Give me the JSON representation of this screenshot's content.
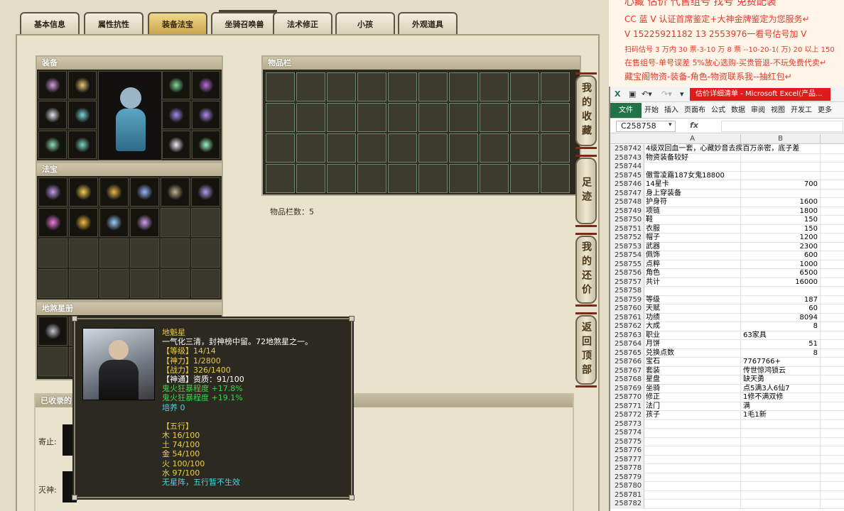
{
  "game": {
    "tabs": [
      "基本信息",
      "属性抗性",
      "装备法宝",
      "坐骑召唤兽",
      "法术修正",
      "小孩",
      "外观道具"
    ],
    "active_tab": "装备法宝",
    "equipment_title": "装备",
    "fabao_title": "法宝",
    "inventory_title": "物品栏",
    "inventory_count": "物品栏数：5",
    "star_title": "地煞星册",
    "collected_title": "已收录的",
    "collected_labels": [
      "寄止:",
      "灭神:"
    ],
    "side_buttons": {
      "favorites": "我的收藏",
      "footprint": "足迹",
      "bargain": "我的还价",
      "back_top": "返回顶部"
    },
    "tooltip": {
      "name": "地魁星",
      "lines": [
        {
          "text": "一气化三清，封神榜中留。72地煞星之一。",
          "color": "white"
        },
        {
          "text": "【等级】14/14",
          "color": "gold"
        },
        {
          "text": "【神力】1/2800",
          "color": "gold"
        },
        {
          "text": "【战力】326/1400",
          "color": "gold"
        },
        {
          "text": "【神通】资质：91/100",
          "color": "white"
        },
        {
          "text": "鬼火狂暴程度 +17.8%",
          "color": "green"
        },
        {
          "text": "鬼火狂暴程度 +19.1%",
          "color": "green"
        },
        {
          "text": "培养 0",
          "color": "cyan"
        },
        {
          "text": "",
          "color": "white"
        },
        {
          "text": "【五行】",
          "color": "gold"
        },
        {
          "text": "木 16/100",
          "color": "yel"
        },
        {
          "text": "土 74/100",
          "color": "yel"
        },
        {
          "text": "金 54/100",
          "color": "yel"
        },
        {
          "text": "火 100/100",
          "color": "yel"
        },
        {
          "text": "水 97/100",
          "color": "yel"
        },
        {
          "text": "无星阵，五行暂不生效",
          "color": "cyan"
        }
      ]
    }
  },
  "ad": {
    "lines": [
      "心藏 估价 代售组号 找号 免费配装",
      "CC 蓝 V 认证首席鉴定+大神金牌鉴定为您服务↵",
      "V 15225921182      13 2553976一看号估号加 V",
      "扫码估号 3 万内 30 票-3-10 万 8 票 --10-20-1( 万) 20 以上 150",
      "在售组号-单号误差 5%放心选购-买贵管退-不玩免费代卖↵",
      "藏宝阁物资-装备-角色-物资联系我--抽红包↵"
    ]
  },
  "excel": {
    "title": "估价详细清单 - Microsoft Excel(产品...",
    "ribbon": [
      "文件",
      "开始",
      "插入",
      "页面布",
      "公式",
      "数据",
      "审阅",
      "视图",
      "开发工",
      "更多"
    ],
    "name_box": "C258758",
    "fx": "fx",
    "col_a": "A",
    "col_b": "B",
    "rows": [
      {
        "n": "258742",
        "a": "4级双回血一套，心藏妙音去疾百万亲密，底子差",
        "b": ""
      },
      {
        "n": "258743",
        "a": "物资装备较好",
        "b": ""
      },
      {
        "n": "258744",
        "a": "",
        "b": ""
      },
      {
        "n": "258745",
        "a": "傲雪凌霜187女鬼18800",
        "b": ""
      },
      {
        "n": "258746",
        "a": "14星卡",
        "b": "700"
      },
      {
        "n": "258747",
        "a": "身上穿装备",
        "b": ""
      },
      {
        "n": "258748",
        "a": "护身符",
        "b": "1600"
      },
      {
        "n": "258749",
        "a": "项链",
        "b": "1800"
      },
      {
        "n": "258750",
        "a": "鞋",
        "b": "150"
      },
      {
        "n": "258751",
        "a": "衣服",
        "b": "150"
      },
      {
        "n": "258752",
        "a": "帽子",
        "b": "1200"
      },
      {
        "n": "258753",
        "a": "武器",
        "b": "2300"
      },
      {
        "n": "258754",
        "a": "佩饰",
        "b": "600"
      },
      {
        "n": "258755",
        "a": "点粹",
        "b": "1000"
      },
      {
        "n": "258756",
        "a": "角色",
        "b": "6500"
      },
      {
        "n": "258757",
        "a": "共计",
        "b": "16000"
      },
      {
        "n": "258758",
        "a": "",
        "b": ""
      },
      {
        "n": "258759",
        "a": "等级",
        "b": "187"
      },
      {
        "n": "258760",
        "a": "天赋",
        "b": "60"
      },
      {
        "n": "258761",
        "a": "功绩",
        "b": "8094"
      },
      {
        "n": "258762",
        "a": "大成",
        "b": "8"
      },
      {
        "n": "258763",
        "a": "职业",
        "b": "63家具"
      },
      {
        "n": "258764",
        "a": "月饼",
        "b": "51"
      },
      {
        "n": "258765",
        "a": "兑换点数",
        "b": "8"
      },
      {
        "n": "258766",
        "a": "宝石",
        "b": "7767766+"
      },
      {
        "n": "258767",
        "a": "套装",
        "b": "传世惊鸿锁云"
      },
      {
        "n": "258768",
        "a": "星盘",
        "b": "缺天勇"
      },
      {
        "n": "258769",
        "a": "坐骑",
        "b": "点5满3人6仙7"
      },
      {
        "n": "258770",
        "a": "修正",
        "b": "1修不满双修"
      },
      {
        "n": "258771",
        "a": "法门",
        "b": "满"
      },
      {
        "n": "258772",
        "a": "孩子",
        "b": "1毛1新"
      },
      {
        "n": "258773",
        "a": "",
        "b": ""
      },
      {
        "n": "258774",
        "a": "",
        "b": ""
      },
      {
        "n": "258775",
        "a": "",
        "b": ""
      },
      {
        "n": "258776",
        "a": "",
        "b": ""
      },
      {
        "n": "258777",
        "a": "",
        "b": ""
      },
      {
        "n": "258778",
        "a": "",
        "b": ""
      },
      {
        "n": "258779",
        "a": "",
        "b": ""
      },
      {
        "n": "258780",
        "a": "",
        "b": ""
      },
      {
        "n": "258781",
        "a": "",
        "b": ""
      },
      {
        "n": "258782",
        "a": "",
        "b": ""
      }
    ]
  },
  "colors": {
    "ad_red": "#e23a2a",
    "excel_green": "#217346",
    "title_red": "#e11b1b",
    "tab_active": "#c9a650"
  }
}
